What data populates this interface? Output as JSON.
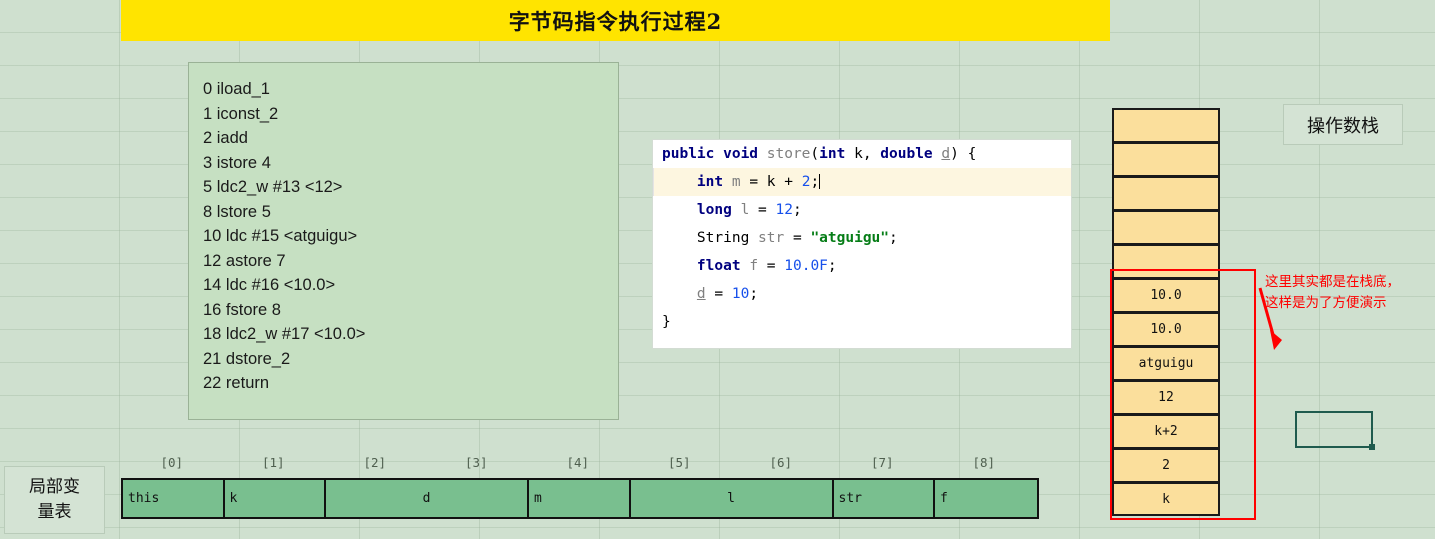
{
  "title": "字节码指令执行过程2",
  "bytecode": {
    "lines": [
      "0 iload_1",
      "1 iconst_2",
      "2 iadd",
      "3 istore 4",
      "5 ldc2_w #13 <12>",
      "8 lstore 5",
      "10 ldc #15 <atguigu>",
      "12 astore 7",
      "14 ldc #16 <10.0>",
      "16 fstore 8",
      "18 ldc2_w #17 <10.0>",
      "21 dstore_2",
      "22 return"
    ]
  },
  "code": {
    "lines": [
      {
        "highlighted": false,
        "tokens": [
          {
            "t": "public ",
            "c": "kw"
          },
          {
            "t": "void ",
            "c": "kw"
          },
          {
            "t": "store",
            "c": "id"
          },
          {
            "t": "(",
            "c": "pn"
          },
          {
            "t": "int",
            "c": "kw"
          },
          {
            "t": " k, ",
            "c": "pn"
          },
          {
            "t": "double",
            "c": "kw"
          },
          {
            "t": " ",
            "c": "pn"
          },
          {
            "t": "d",
            "c": "idu"
          },
          {
            "t": ") {",
            "c": "pn"
          }
        ]
      },
      {
        "highlighted": true,
        "caret": true,
        "tokens": [
          {
            "t": "    ",
            "c": "pn"
          },
          {
            "t": "int",
            "c": "kw"
          },
          {
            "t": " ",
            "c": "pn"
          },
          {
            "t": "m",
            "c": "id"
          },
          {
            "t": " = k + ",
            "c": "pn"
          },
          {
            "t": "2",
            "c": "num"
          },
          {
            "t": ";",
            "c": "pn"
          }
        ]
      },
      {
        "highlighted": false,
        "tokens": [
          {
            "t": "    ",
            "c": "pn"
          },
          {
            "t": "long",
            "c": "kw"
          },
          {
            "t": " ",
            "c": "pn"
          },
          {
            "t": "l",
            "c": "id"
          },
          {
            "t": " = ",
            "c": "pn"
          },
          {
            "t": "12",
            "c": "num"
          },
          {
            "t": ";",
            "c": "pn"
          }
        ]
      },
      {
        "highlighted": false,
        "tokens": [
          {
            "t": "    ",
            "c": "pn"
          },
          {
            "t": "String",
            "c": "pn"
          },
          {
            "t": " ",
            "c": "pn"
          },
          {
            "t": "str",
            "c": "id"
          },
          {
            "t": " = ",
            "c": "pn"
          },
          {
            "t": "\"atguigu\"",
            "c": "str"
          },
          {
            "t": ";",
            "c": "pn"
          }
        ]
      },
      {
        "highlighted": false,
        "tokens": [
          {
            "t": "    ",
            "c": "pn"
          },
          {
            "t": "float",
            "c": "kw"
          },
          {
            "t": " ",
            "c": "pn"
          },
          {
            "t": "f",
            "c": "id"
          },
          {
            "t": " = ",
            "c": "pn"
          },
          {
            "t": "10.0F",
            "c": "num"
          },
          {
            "t": ";",
            "c": "pn"
          }
        ]
      },
      {
        "highlighted": false,
        "tokens": [
          {
            "t": "    ",
            "c": "pn"
          },
          {
            "t": "d",
            "c": "idu"
          },
          {
            "t": " = ",
            "c": "pn"
          },
          {
            "t": "10",
            "c": "num"
          },
          {
            "t": ";",
            "c": "pn"
          }
        ]
      },
      {
        "highlighted": false,
        "tokens": [
          {
            "t": "}",
            "c": "pn"
          }
        ]
      }
    ]
  },
  "operand_stack": {
    "label": "操作数栈",
    "cells": [
      "",
      "",
      "",
      "",
      "",
      "10.0",
      "10.0",
      "atguigu",
      "12",
      "k+2",
      "2",
      "k"
    ],
    "note": "这里其实都是在栈底，\n这样是为了方便演示",
    "note_color": "#ff0000",
    "highlight_color": "#ff0000"
  },
  "local_variable_table": {
    "label_line1": "局部变",
    "label_line2": "量表",
    "indices": [
      "[0]",
      "[1]",
      "[2]",
      "[3]",
      "[4]",
      "[5]",
      "[6]",
      "[7]",
      "[8]"
    ],
    "slots": [
      {
        "value": "this",
        "span": 1,
        "align": "left"
      },
      {
        "value": "k",
        "span": 1,
        "align": "left"
      },
      {
        "value": "d",
        "span": 2,
        "align": "center"
      },
      {
        "value": "m",
        "span": 1,
        "align": "left"
      },
      {
        "value": "l",
        "span": 2,
        "align": "center"
      },
      {
        "value": "str",
        "span": 1,
        "align": "left"
      },
      {
        "value": "f",
        "span": 1,
        "align": "left"
      }
    ]
  },
  "colors": {
    "background": "#cfe0cf",
    "banner": "#FFE400",
    "bytecode_panel": "#c6e0c2",
    "stack_cell": "#fbdf9c",
    "lvt_cell": "#79bf8f"
  }
}
